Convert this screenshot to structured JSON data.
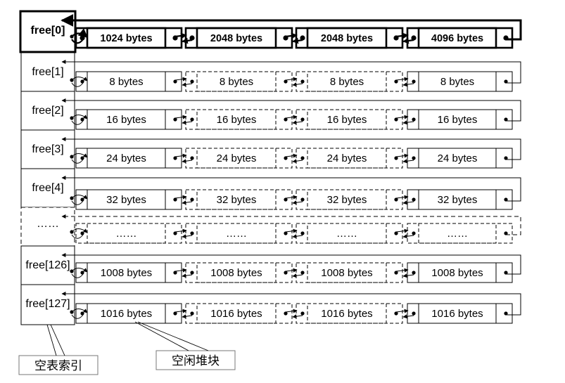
{
  "index_labels": [
    "free[0]",
    "free[1]",
    "free[2]",
    "free[3]",
    "free[4]",
    "……",
    "free[126]",
    "free[127]"
  ],
  "rows": [
    [
      "1024 bytes",
      "2048 bytes",
      "2048 bytes",
      "4096 bytes"
    ],
    [
      "8 bytes",
      "8 bytes",
      "8 bytes",
      "8 bytes"
    ],
    [
      "16 bytes",
      "16 bytes",
      "16 bytes",
      "16 bytes"
    ],
    [
      "24 bytes",
      "24 bytes",
      "24 bytes",
      "24 bytes"
    ],
    [
      "32 bytes",
      "32 bytes",
      "32 bytes",
      "32 bytes"
    ],
    [
      "……",
      "……",
      "……",
      "……"
    ],
    [
      "1008 bytes",
      "1008 bytes",
      "1008 bytes",
      "1008 bytes"
    ],
    [
      "1016 bytes",
      "1016 bytes",
      "1016 bytes",
      "1016 bytes"
    ]
  ],
  "captions": {
    "index": "空表索引",
    "blocks": "空闲堆块"
  }
}
